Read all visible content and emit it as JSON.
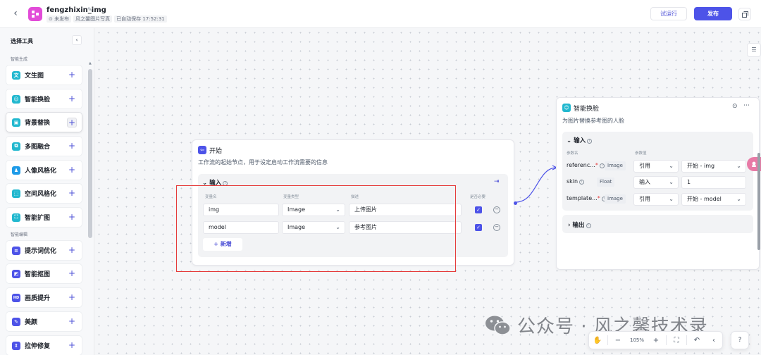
{
  "header": {
    "app_name": "fengzhixin_img",
    "meta": [
      "⊙ 未发布",
      "风之馨图片写真",
      "已自动保存 17:52:31"
    ],
    "test_run_label": "试运行",
    "publish_label": "发布",
    "accent": "#4d53e8"
  },
  "sidebar": {
    "title": "选择工具",
    "collapse_icon": "‹",
    "sections": [
      {
        "label": "智能生成"
      },
      {
        "label": "智能编辑"
      }
    ],
    "tools": [
      {
        "label": "文生图",
        "icon": "文",
        "color": "#22b8cf"
      },
      {
        "label": "智能换脸",
        "icon": "☺",
        "color": "#22b8cf"
      },
      {
        "label": "背景替换",
        "icon": "▣",
        "color": "#22b8cf"
      },
      {
        "label": "多图融合",
        "icon": "⧉",
        "color": "#22b8cf"
      },
      {
        "label": "人像风格化",
        "icon": "♟",
        "color": "#1e9be8"
      },
      {
        "label": "空间风格化",
        "icon": "⬚",
        "color": "#22b8cf"
      },
      {
        "label": "智能扩图",
        "icon": "⛶",
        "color": "#22b8cf"
      },
      {
        "label": "提示词优化",
        "icon": "≡",
        "color": "#4d53e8"
      },
      {
        "label": "智能抠图",
        "icon": "◩",
        "color": "#4d53e8"
      },
      {
        "label": "画质提升",
        "icon": "HD",
        "color": "#4d53e8"
      },
      {
        "label": "美颜",
        "icon": "✎",
        "color": "#4d53e8"
      },
      {
        "label": "拉伸修复",
        "icon": "⇕",
        "color": "#4d53e8"
      }
    ],
    "add_icon": "+"
  },
  "start_node": {
    "title": "开始",
    "description": "工作流的起始节点，用于设定启动工作流需要的信息",
    "input_section": "输入",
    "columns": [
      "变量名",
      "变量类型",
      "描述",
      "是否必要"
    ],
    "rows": [
      {
        "name": "img",
        "type": "Image",
        "desc": "上传图片"
      },
      {
        "name": "model",
        "type": "Image",
        "desc": "参考图片"
      }
    ],
    "add_label": "+ 新增"
  },
  "swap_node": {
    "title": "智能换脸",
    "description": "为图片替换参考图的人脸",
    "input_section": "输入",
    "columns": [
      "参数名",
      "参数值"
    ],
    "params": [
      {
        "name": "referenc...",
        "required": true,
        "tag": "Image",
        "mode": "引用",
        "value": "开始 - img"
      },
      {
        "name": "skin",
        "required": false,
        "tag": "Float",
        "mode": "输入",
        "value": "1"
      },
      {
        "name": "template...",
        "required": true,
        "tag": "Image",
        "mode": "引用",
        "value": "开始 - model"
      }
    ],
    "output_section": "输出"
  },
  "toolbar": {
    "zoom": "105%"
  },
  "watermark": "公众号 · 风之馨技术录"
}
